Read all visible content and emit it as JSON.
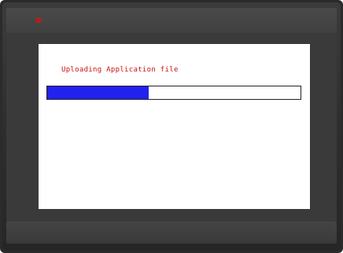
{
  "screen": {
    "status_text": "Uploading Application file"
  },
  "progress": {
    "fraction": 0.4,
    "fill_color": "#2222ee",
    "track_color": "#ffffff"
  },
  "device": {
    "led_color": "#d01010"
  }
}
